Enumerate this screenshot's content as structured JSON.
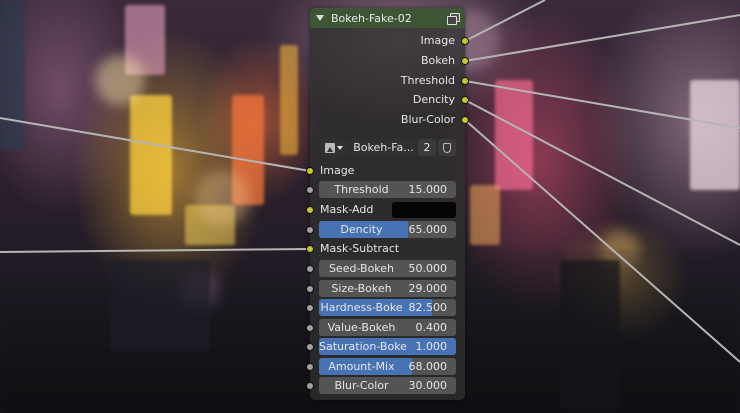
{
  "node": {
    "title": "Bokeh-Fake-02",
    "header_color": "#3e5834",
    "outputs": [
      "Image",
      "Bokeh",
      "Threshold",
      "Dencity",
      "Blur-Color"
    ],
    "group": {
      "name": "Bokeh-Fa...",
      "users": "2"
    },
    "inputs": {
      "image": "Image",
      "threshold": {
        "label": "Threshold",
        "value": "15.000"
      },
      "mask_add": "Mask-Add",
      "dencity": {
        "label": "Dencity",
        "value": "65.000",
        "fill": 0.65
      },
      "mask_subtract": "Mask-Subtract",
      "seed_bokeh": {
        "label": "Seed-Bokeh",
        "value": "50.000"
      },
      "size_bokeh": {
        "label": "Size-Bokeh",
        "value": "29.000"
      },
      "hardness_bokeh": {
        "label": "Hardness-Boke",
        "value": "82.500",
        "fill": 0.825
      },
      "value_bokeh": {
        "label": "Value-Bokeh",
        "value": "0.400"
      },
      "saturation_bokeh": {
        "label": "Saturation-Boke",
        "value": "1.000",
        "fill": 1.0
      },
      "amount_mix": {
        "label": "Amount-Mix",
        "value": "68.000",
        "fill": 0.68
      },
      "blur_color": {
        "label": "Blur-Color",
        "value": "30.000"
      }
    }
  },
  "colors": {
    "socket_color": "#c7c729",
    "socket_value": "#a1a1a1",
    "slider_fill": "#4772b3"
  }
}
